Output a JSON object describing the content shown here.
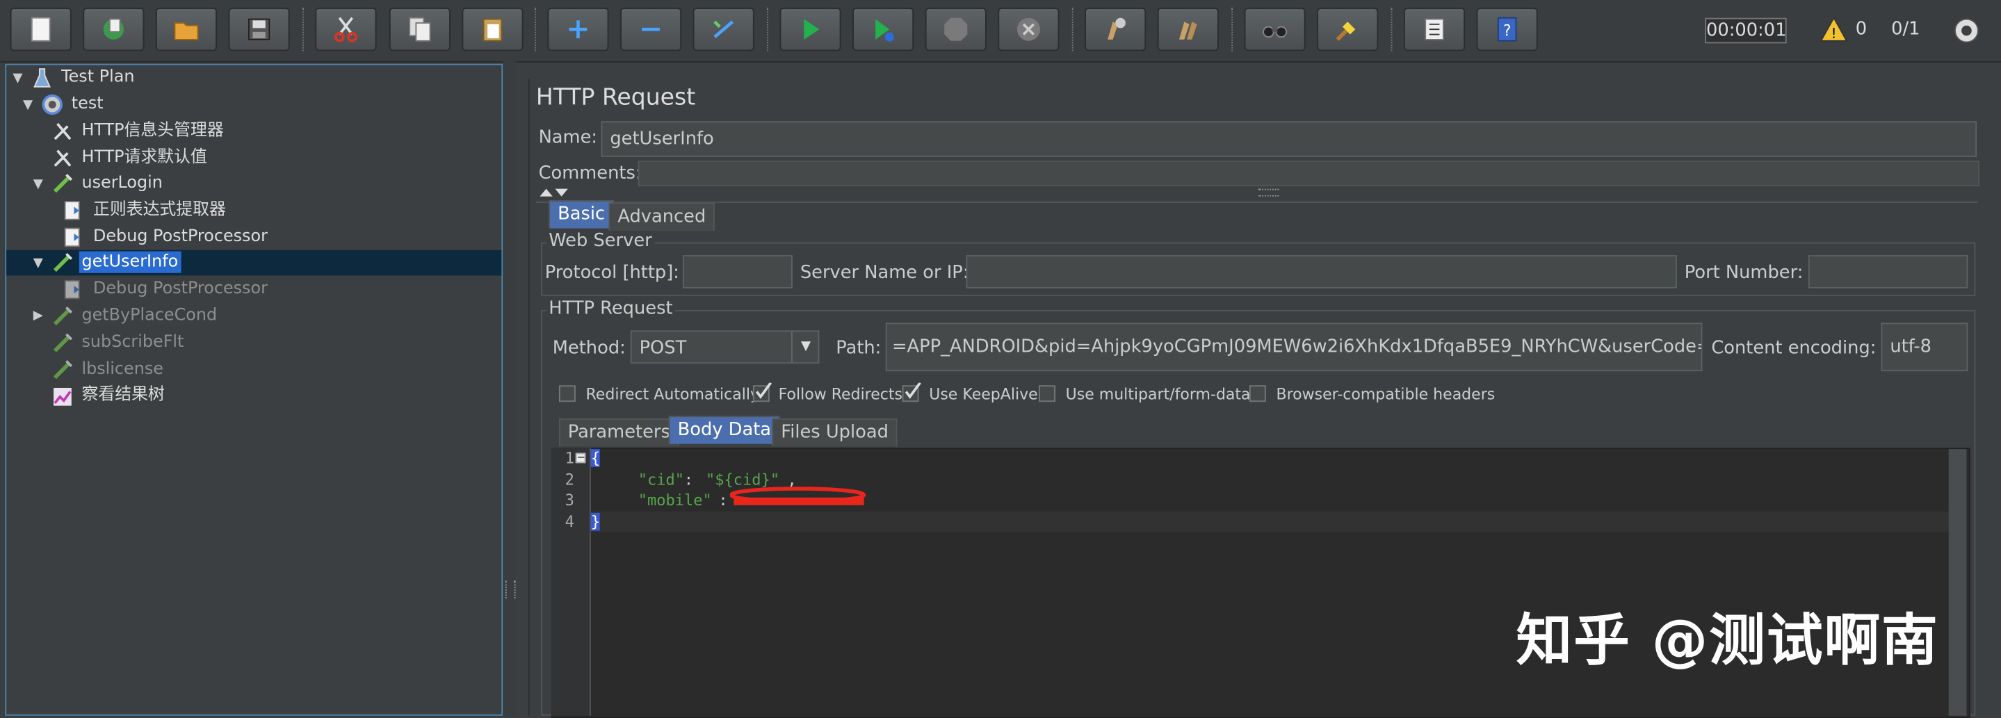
{
  "toolbar": {
    "buttons": [
      "new",
      "templates",
      "open",
      "save",
      "cut",
      "copy",
      "paste",
      "expand",
      "collapse",
      "toggle",
      "start",
      "start-no-pauses",
      "stop",
      "shutdown",
      "clear",
      "clear-all",
      "search",
      "reset-search",
      "function-helper",
      "help"
    ],
    "timer": "00:00:01",
    "warning_count": "0",
    "threads": "0/1"
  },
  "tree": {
    "items": [
      {
        "label": "Test Plan",
        "icon": "flask-icon"
      },
      {
        "label": "test",
        "icon": "gear-icon"
      },
      {
        "label": "HTTP信息头管理器",
        "icon": "wrench-icon"
      },
      {
        "label": "HTTP请求默认值",
        "icon": "wrench-icon"
      },
      {
        "label": "userLogin",
        "icon": "pipette-icon"
      },
      {
        "label": "正则表达式提取器",
        "icon": "document-icon"
      },
      {
        "label": "Debug PostProcessor",
        "icon": "document-icon"
      },
      {
        "label": "getUserInfo",
        "icon": "pipette-icon",
        "selected": true
      },
      {
        "label": "Debug PostProcessor",
        "icon": "document-icon"
      },
      {
        "label": "getByPlaceCond",
        "icon": "pipette-icon"
      },
      {
        "label": "subScribeFlt",
        "icon": "pipette-icon"
      },
      {
        "label": "lbslicense",
        "icon": "pipette-icon"
      },
      {
        "label": "察看结果树",
        "icon": "chart-icon"
      }
    ]
  },
  "panel": {
    "title": "HTTP Request",
    "name_label": "Name:",
    "name_value": "getUserInfo",
    "comments_label": "Comments:",
    "tabs": [
      "Basic",
      "Advanced"
    ],
    "web_server": {
      "legend": "Web Server",
      "protocol_label": "Protocol [http]:",
      "protocol_value": "",
      "server_label": "Server Name or IP:",
      "server_value": "",
      "port_label": "Port Number:",
      "port_value": ""
    },
    "http_request": {
      "legend": "HTTP Request",
      "method_label": "Method:",
      "method_value": "POST",
      "path_label": "Path:",
      "path_value": "=APP_ANDROID&pid=Ahjpk9yoCGPmJ09MEW6w2i6XhKdx1DfqaB5E9_NRYhCW&userCode=",
      "encoding_label": "Content encoding:",
      "encoding_value": "utf-8"
    },
    "checkboxes": [
      {
        "label": "Redirect Automatically",
        "checked": false
      },
      {
        "label": "Follow Redirects",
        "checked": true
      },
      {
        "label": "Use KeepAlive",
        "checked": true
      },
      {
        "label": "Use multipart/form-data",
        "checked": false
      },
      {
        "label": "Browser-compatible headers",
        "checked": false
      }
    ],
    "body_tabs": [
      "Parameters",
      "Body Data",
      "Files Upload"
    ],
    "body": {
      "line_numbers": [
        "1",
        "2",
        "3",
        "4"
      ],
      "open_brace": "{",
      "cid_key": "\"cid\"",
      "cid_colon": ": ",
      "cid_value": "\"${cid}\"",
      "cid_comma": ",",
      "mobile_key": "\"mobile\"",
      "mobile_colon": ":",
      "close_brace": "}"
    }
  },
  "watermark": "知乎 @测试啊南",
  "colors": {
    "accent": "#4b6eaf",
    "selection": "#2a6bd2",
    "code_key": "#57a64a",
    "redaction": "#e8261c"
  }
}
